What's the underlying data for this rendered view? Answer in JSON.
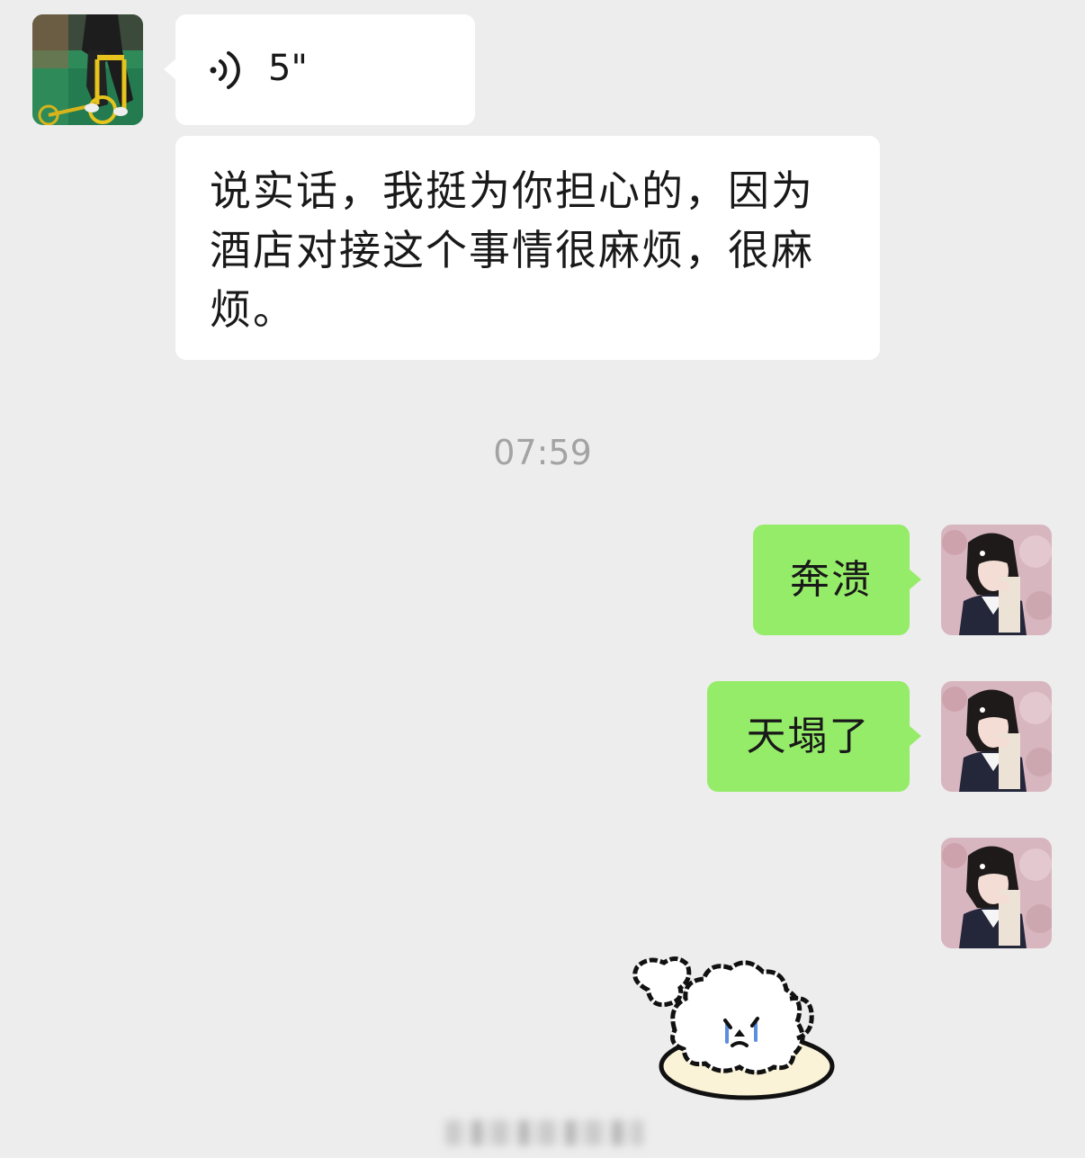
{
  "chat": {
    "messages": [
      {
        "sender": "contact",
        "type": "voice",
        "avatar_icon": "contact-avatar-photo",
        "voice_icon": "voice-wave-icon",
        "duration": "5\""
      },
      {
        "sender": "contact",
        "type": "text",
        "text": "说实话，我挺为你担心的，因为酒店对接这个事情很麻烦，很麻烦。"
      },
      {
        "sender": "self",
        "type": "text",
        "avatar_icon": "user-avatar-photo",
        "text": "奔溃"
      },
      {
        "sender": "self",
        "type": "text",
        "avatar_icon": "user-avatar-photo",
        "text": "天塌了"
      },
      {
        "sender": "self",
        "type": "sticker",
        "avatar_icon": "user-avatar-photo",
        "sticker_icon": "crying-puppy-sticker"
      }
    ],
    "timestamp": "07:59"
  },
  "colors": {
    "background": "#ededed",
    "incoming_bubble": "#ffffff",
    "outgoing_bubble": "#95ec69",
    "timestamp_text": "#a3a3a3"
  }
}
